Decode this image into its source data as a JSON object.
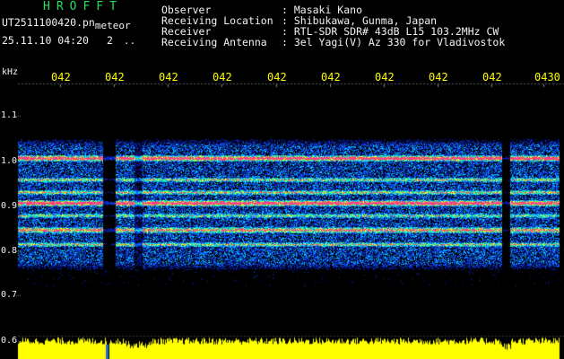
{
  "app": {
    "name": "HROFFT",
    "filename": "UT2511100420.pn",
    "filename_tag": "meteor",
    "timestamp": "25.11.10 04:20",
    "count": "2",
    "count_suffix": ".."
  },
  "header": {
    "rows": [
      {
        "label": "Observer",
        "value": ": Masaki Kano"
      },
      {
        "label": "Receiving Location",
        "value": ": Shibukawa, Gunma, Japan"
      },
      {
        "label": "Receiver",
        "value": ": RTL-SDR SDR# 43dB L15 103.2MHz CW"
      },
      {
        "label": "Receiving Antenna",
        "value": ": 3el Yagi(V) Az 330 for Vladivostok"
      }
    ]
  },
  "axis": {
    "unit": "kHz",
    "y_ticks": [
      "1.1",
      "1.0",
      "0.9",
      "0.8",
      "0.7",
      "0.6"
    ],
    "time_ticks": [
      "042",
      "042",
      "042",
      "042",
      "042",
      "042",
      "042",
      "042",
      "042",
      "0430"
    ]
  },
  "colors": {
    "background": "#000000",
    "title": "#22e05a",
    "text": "#f2f2f2",
    "time_labels": "#ffff00",
    "power_fill": "#ffff00"
  }
}
